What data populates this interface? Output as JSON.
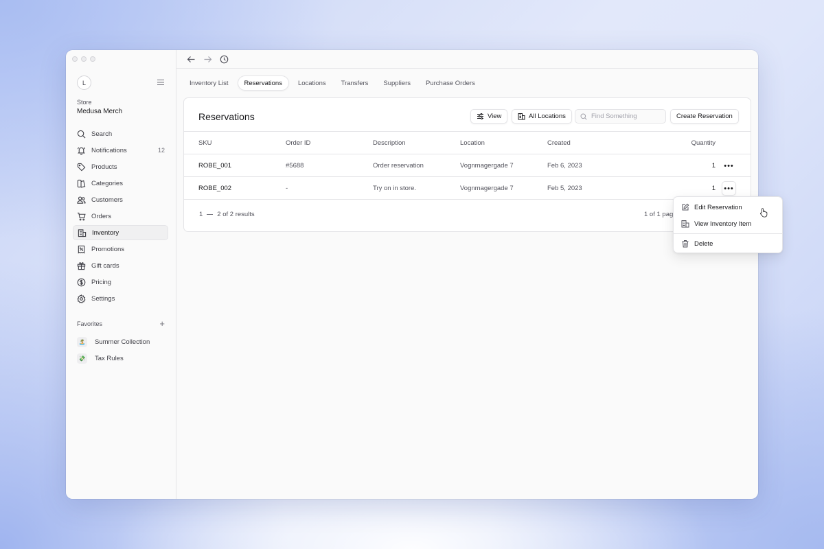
{
  "sidebar": {
    "avatar_letter": "L",
    "store_label": "Store",
    "store_name": "Medusa Merch",
    "nav": [
      {
        "label": "Search",
        "icon": "search-icon"
      },
      {
        "label": "Notifications",
        "icon": "bell-icon",
        "count": "12"
      },
      {
        "label": "Products",
        "icon": "tag-icon"
      },
      {
        "label": "Categories",
        "icon": "categories-icon"
      },
      {
        "label": "Customers",
        "icon": "users-icon"
      },
      {
        "label": "Orders",
        "icon": "cart-icon"
      },
      {
        "label": "Inventory",
        "icon": "buildings-icon",
        "active": true
      },
      {
        "label": "Promotions",
        "icon": "receipt-percent-icon"
      },
      {
        "label": "Gift cards",
        "icon": "gift-icon"
      },
      {
        "label": "Pricing",
        "icon": "currency-dollar-icon"
      },
      {
        "label": "Settings",
        "icon": "cog-icon"
      }
    ],
    "favorites_title": "Favorites",
    "favorites_add": "+",
    "favorites": [
      {
        "label": "Summer Collection",
        "emoji": "🏝️"
      },
      {
        "label": "Tax Rules",
        "emoji": "💸"
      }
    ]
  },
  "tabs": [
    {
      "label": "Inventory List"
    },
    {
      "label": "Reservations",
      "active": true
    },
    {
      "label": "Locations"
    },
    {
      "label": "Transfers"
    },
    {
      "label": "Suppliers"
    },
    {
      "label": "Purchase Orders"
    }
  ],
  "card": {
    "title": "Reservations",
    "view_button": "View",
    "locations_button": "All Locations",
    "search_placeholder": "Find Something",
    "create_button": "Create Reservation"
  },
  "table": {
    "columns": {
      "sku": "SKU",
      "order": "Order ID",
      "desc": "Description",
      "loc": "Location",
      "created": "Created",
      "qty": "Quantity"
    },
    "rows": [
      {
        "sku": "ROBE_001",
        "order": "#5688",
        "desc": "Order reservation",
        "loc": "Vognmagergade 7",
        "created": "Feb 6, 2023",
        "qty": "1"
      },
      {
        "sku": "ROBE_002",
        "order": "-",
        "desc": "Try on in store.",
        "loc": "Vognmagergade 7",
        "created": "Feb 5, 2023",
        "qty": "1"
      }
    ],
    "row_menu_glyph": "•••"
  },
  "footer": {
    "range_start": "1",
    "range_text": "2 of 2 results",
    "pages_text": "1 of 1 pages"
  },
  "dropdown": {
    "edit": "Edit Reservation",
    "view_item": "View Inventory Item",
    "delete": "Delete"
  }
}
